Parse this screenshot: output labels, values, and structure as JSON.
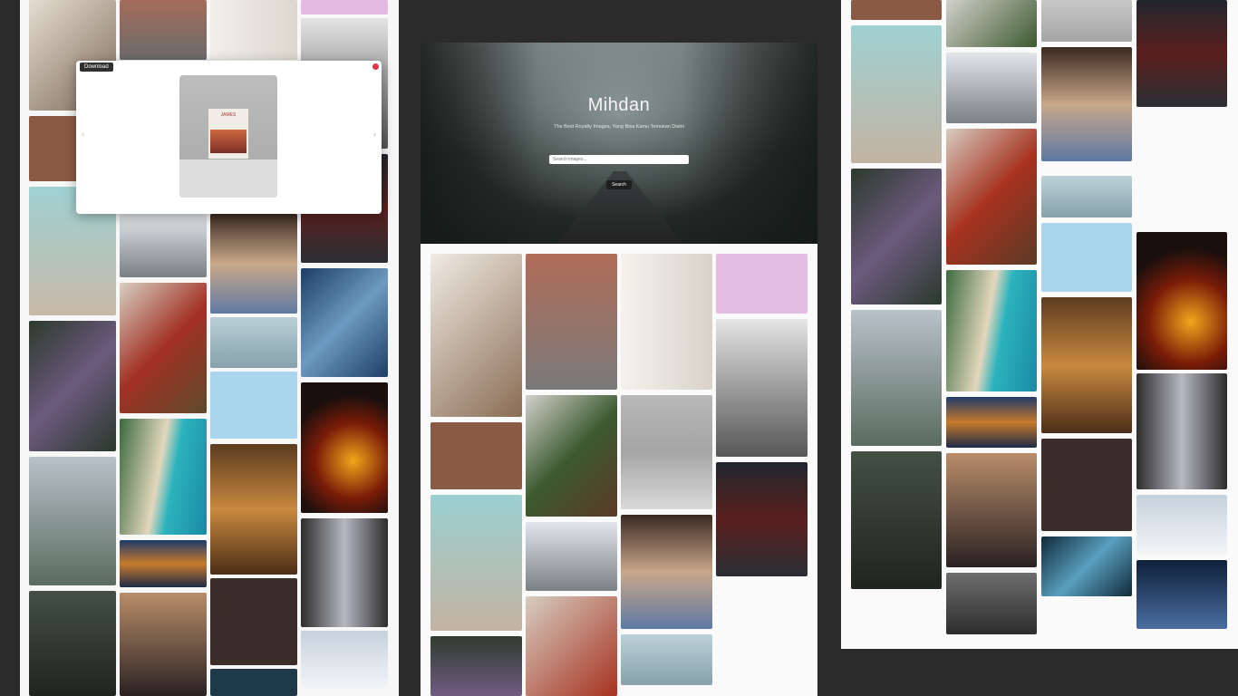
{
  "site": {
    "title": "Mihdan",
    "subtitle": "The Best Royalty Images, Yang Bisa Kamu Temukan Disini",
    "search_placeholder": "Search images...",
    "search_button": "Search"
  },
  "modal": {
    "download_label": "Download",
    "book_title": "JAMES"
  }
}
